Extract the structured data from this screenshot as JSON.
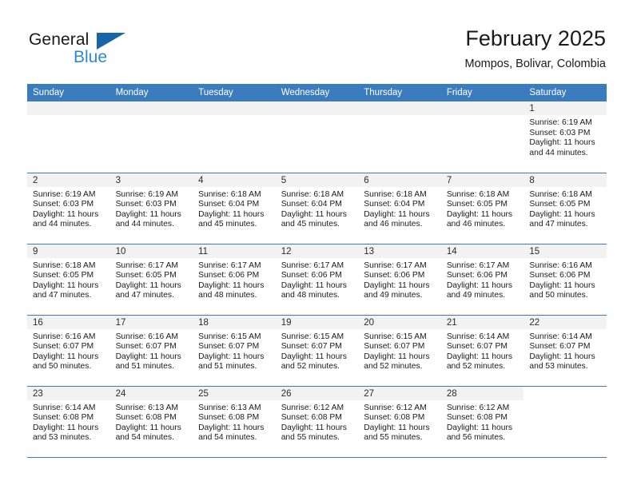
{
  "brand": {
    "name_dark": "General",
    "name_blue": "Blue",
    "triangle_color": "#1565a8",
    "blue_color": "#2b8ad6"
  },
  "header": {
    "title": "February 2025",
    "subtitle": "Mompos, Bolivar, Colombia"
  },
  "theme": {
    "header_row_bg": "#3a7cbe",
    "daynum_band_bg": "#f2f2f2",
    "row_border": "#3a7cbe",
    "text": "#1a1a1a"
  },
  "weekday_headers": [
    "Sunday",
    "Monday",
    "Tuesday",
    "Wednesday",
    "Thursday",
    "Friday",
    "Saturday"
  ],
  "labels": {
    "sunrise_prefix": "Sunrise:",
    "sunset_prefix": "Sunset:",
    "daylight_prefix": "Daylight:"
  },
  "weeks": [
    [
      {
        "day": "",
        "empty": true
      },
      {
        "day": "",
        "empty": true
      },
      {
        "day": "",
        "empty": true
      },
      {
        "day": "",
        "empty": true
      },
      {
        "day": "",
        "empty": true
      },
      {
        "day": "",
        "empty": true
      },
      {
        "day": "1",
        "sunrise": "Sunrise: 6:19 AM",
        "sunset": "Sunset: 6:03 PM",
        "daylight": "Daylight: 11 hours and 44 minutes."
      }
    ],
    [
      {
        "day": "2",
        "sunrise": "Sunrise: 6:19 AM",
        "sunset": "Sunset: 6:03 PM",
        "daylight": "Daylight: 11 hours and 44 minutes."
      },
      {
        "day": "3",
        "sunrise": "Sunrise: 6:19 AM",
        "sunset": "Sunset: 6:03 PM",
        "daylight": "Daylight: 11 hours and 44 minutes."
      },
      {
        "day": "4",
        "sunrise": "Sunrise: 6:18 AM",
        "sunset": "Sunset: 6:04 PM",
        "daylight": "Daylight: 11 hours and 45 minutes."
      },
      {
        "day": "5",
        "sunrise": "Sunrise: 6:18 AM",
        "sunset": "Sunset: 6:04 PM",
        "daylight": "Daylight: 11 hours and 45 minutes."
      },
      {
        "day": "6",
        "sunrise": "Sunrise: 6:18 AM",
        "sunset": "Sunset: 6:04 PM",
        "daylight": "Daylight: 11 hours and 46 minutes."
      },
      {
        "day": "7",
        "sunrise": "Sunrise: 6:18 AM",
        "sunset": "Sunset: 6:05 PM",
        "daylight": "Daylight: 11 hours and 46 minutes."
      },
      {
        "day": "8",
        "sunrise": "Sunrise: 6:18 AM",
        "sunset": "Sunset: 6:05 PM",
        "daylight": "Daylight: 11 hours and 47 minutes."
      }
    ],
    [
      {
        "day": "9",
        "sunrise": "Sunrise: 6:18 AM",
        "sunset": "Sunset: 6:05 PM",
        "daylight": "Daylight: 11 hours and 47 minutes."
      },
      {
        "day": "10",
        "sunrise": "Sunrise: 6:17 AM",
        "sunset": "Sunset: 6:05 PM",
        "daylight": "Daylight: 11 hours and 47 minutes."
      },
      {
        "day": "11",
        "sunrise": "Sunrise: 6:17 AM",
        "sunset": "Sunset: 6:06 PM",
        "daylight": "Daylight: 11 hours and 48 minutes."
      },
      {
        "day": "12",
        "sunrise": "Sunrise: 6:17 AM",
        "sunset": "Sunset: 6:06 PM",
        "daylight": "Daylight: 11 hours and 48 minutes."
      },
      {
        "day": "13",
        "sunrise": "Sunrise: 6:17 AM",
        "sunset": "Sunset: 6:06 PM",
        "daylight": "Daylight: 11 hours and 49 minutes."
      },
      {
        "day": "14",
        "sunrise": "Sunrise: 6:17 AM",
        "sunset": "Sunset: 6:06 PM",
        "daylight": "Daylight: 11 hours and 49 minutes."
      },
      {
        "day": "15",
        "sunrise": "Sunrise: 6:16 AM",
        "sunset": "Sunset: 6:06 PM",
        "daylight": "Daylight: 11 hours and 50 minutes."
      }
    ],
    [
      {
        "day": "16",
        "sunrise": "Sunrise: 6:16 AM",
        "sunset": "Sunset: 6:07 PM",
        "daylight": "Daylight: 11 hours and 50 minutes."
      },
      {
        "day": "17",
        "sunrise": "Sunrise: 6:16 AM",
        "sunset": "Sunset: 6:07 PM",
        "daylight": "Daylight: 11 hours and 51 minutes."
      },
      {
        "day": "18",
        "sunrise": "Sunrise: 6:15 AM",
        "sunset": "Sunset: 6:07 PM",
        "daylight": "Daylight: 11 hours and 51 minutes."
      },
      {
        "day": "19",
        "sunrise": "Sunrise: 6:15 AM",
        "sunset": "Sunset: 6:07 PM",
        "daylight": "Daylight: 11 hours and 52 minutes."
      },
      {
        "day": "20",
        "sunrise": "Sunrise: 6:15 AM",
        "sunset": "Sunset: 6:07 PM",
        "daylight": "Daylight: 11 hours and 52 minutes."
      },
      {
        "day": "21",
        "sunrise": "Sunrise: 6:14 AM",
        "sunset": "Sunset: 6:07 PM",
        "daylight": "Daylight: 11 hours and 52 minutes."
      },
      {
        "day": "22",
        "sunrise": "Sunrise: 6:14 AM",
        "sunset": "Sunset: 6:07 PM",
        "daylight": "Daylight: 11 hours and 53 minutes."
      }
    ],
    [
      {
        "day": "23",
        "sunrise": "Sunrise: 6:14 AM",
        "sunset": "Sunset: 6:08 PM",
        "daylight": "Daylight: 11 hours and 53 minutes."
      },
      {
        "day": "24",
        "sunrise": "Sunrise: 6:13 AM",
        "sunset": "Sunset: 6:08 PM",
        "daylight": "Daylight: 11 hours and 54 minutes."
      },
      {
        "day": "25",
        "sunrise": "Sunrise: 6:13 AM",
        "sunset": "Sunset: 6:08 PM",
        "daylight": "Daylight: 11 hours and 54 minutes."
      },
      {
        "day": "26",
        "sunrise": "Sunrise: 6:12 AM",
        "sunset": "Sunset: 6:08 PM",
        "daylight": "Daylight: 11 hours and 55 minutes."
      },
      {
        "day": "27",
        "sunrise": "Sunrise: 6:12 AM",
        "sunset": "Sunset: 6:08 PM",
        "daylight": "Daylight: 11 hours and 55 minutes."
      },
      {
        "day": "28",
        "sunrise": "Sunrise: 6:12 AM",
        "sunset": "Sunset: 6:08 PM",
        "daylight": "Daylight: 11 hours and 56 minutes."
      },
      {
        "day": "",
        "empty": true,
        "trailing": true
      }
    ]
  ]
}
